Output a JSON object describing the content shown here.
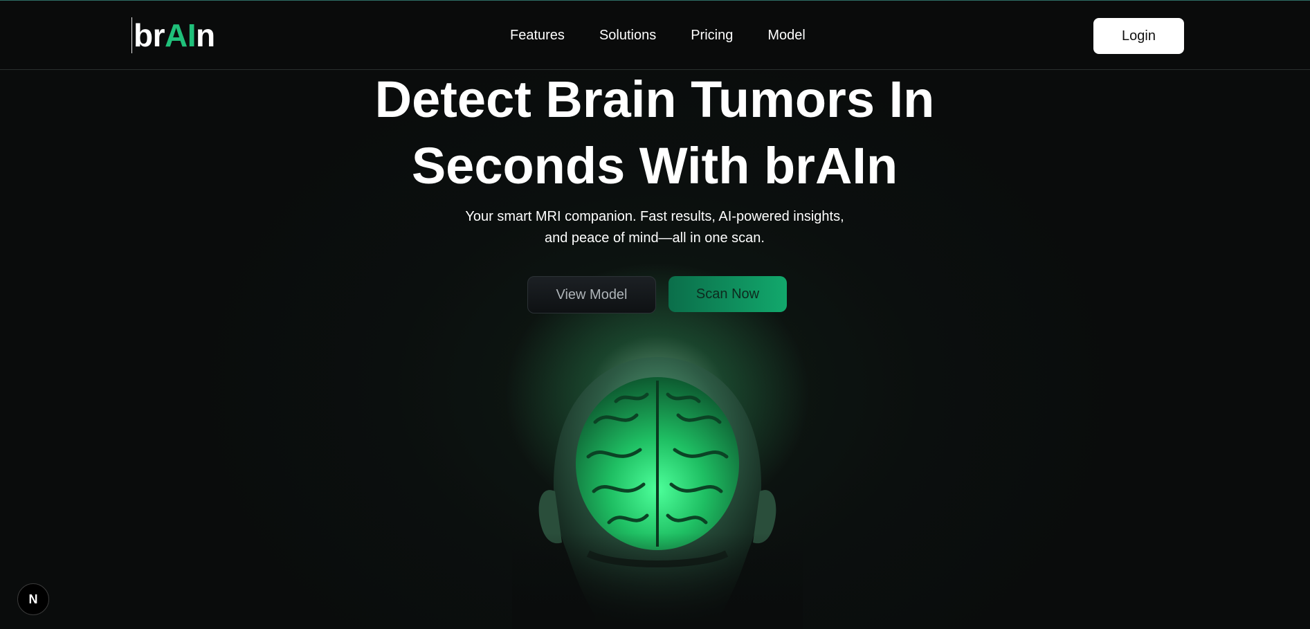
{
  "brand": {
    "name_prefix": "br",
    "name_highlight": "AI",
    "name_suffix": "n",
    "accent_color": "#20c07a"
  },
  "nav": {
    "links": [
      "Features",
      "Solutions",
      "Pricing",
      "Model"
    ],
    "login_label": "Login"
  },
  "hero": {
    "title_line1": "Detect Brain Tumors In",
    "title_line2": "Seconds With brAIn",
    "subtitle_line1": "Your smart MRI companion. Fast results, AI-powered insights,",
    "subtitle_line2": "and peace of mind—all in one scan.",
    "view_model_label": "View Model",
    "scan_now_label": "Scan Now"
  },
  "dev_badge": {
    "label": "N",
    "icon": "nextjs-icon"
  }
}
